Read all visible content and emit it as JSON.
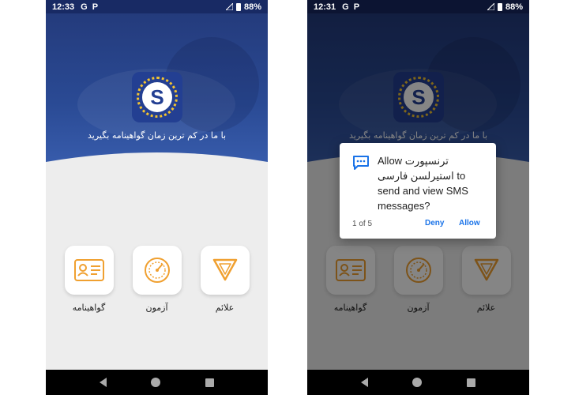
{
  "screens": {
    "left": {
      "status": {
        "time": "12:33",
        "icon1": "G",
        "icon2": "P",
        "battery": "88%"
      },
      "tagline": "با ما در کم ترین زمان گواهینامه بگیرید",
      "tiles": [
        {
          "icon": "id-card-icon",
          "label": "گواهینامه"
        },
        {
          "icon": "speedometer-icon",
          "label": "آزمون"
        },
        {
          "icon": "yield-sign-icon",
          "label": "علائم"
        }
      ]
    },
    "right": {
      "status": {
        "time": "12:31",
        "icon1": "G",
        "icon2": "P",
        "battery": "88%"
      },
      "tagline": "با ما در کم ترین زمان گواهینامه بگیرید",
      "tiles": [
        {
          "icon": "id-card-icon",
          "label": "گواهینامه"
        },
        {
          "icon": "speedometer-icon",
          "label": "آزمون"
        },
        {
          "icon": "yield-sign-icon",
          "label": "علائم"
        }
      ],
      "dialog": {
        "icon": "sms-icon",
        "text_allow": "Allow",
        "app_name": "ترنسپورت استیرلسن فارسی",
        "text_rest": "to send and view SMS messages?",
        "counter": "1 of 5",
        "deny_label": "Deny",
        "allow_label": "Allow"
      }
    }
  },
  "colors": {
    "brand_blue": "#233f92",
    "accent_orange": "#f0a030",
    "dialog_button": "#1a73e8"
  },
  "logo_letter": "S"
}
